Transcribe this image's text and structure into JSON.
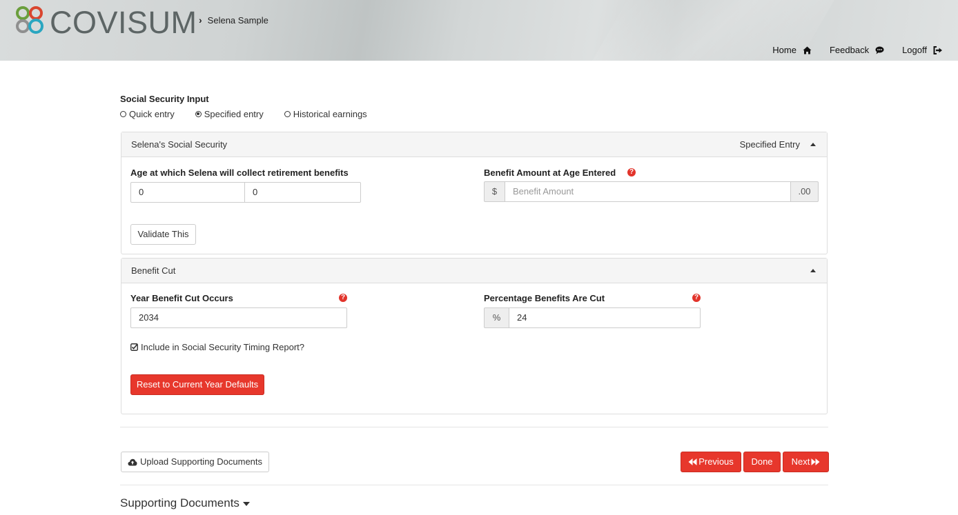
{
  "header": {
    "brand": "COVISUM",
    "breadcrumb": "Selena Sample",
    "nav": {
      "home": "Home",
      "feedback": "Feedback",
      "logoff": "Logoff"
    }
  },
  "ss_input": {
    "title": "Social Security Input",
    "options": {
      "quick": "Quick entry",
      "specified": "Specified entry",
      "historical": "Historical earnings"
    },
    "selected": "Specified entry"
  },
  "ss_panel": {
    "heading": "Selena's Social Security",
    "mode": "Specified Entry",
    "age_label": "Age at which Selena will collect retirement benefits",
    "age_years": "0",
    "age_months": "0",
    "benefit_label": "Benefit Amount at Age Entered",
    "benefit_prefix": "$",
    "benefit_placeholder": "Benefit Amount",
    "benefit_suffix": ".00",
    "validate_button": "Validate This"
  },
  "cut_panel": {
    "heading": "Benefit Cut",
    "year_label": "Year Benefit Cut Occurs",
    "year_value": "2034",
    "pct_label": "Percentage Benefits Are Cut",
    "pct_prefix": "%",
    "pct_value": "24",
    "include_label": "Include in Social Security Timing Report?",
    "include_checked": true,
    "reset_button": "Reset to Current Year Defaults"
  },
  "footer": {
    "upload_button": "Upload Supporting Documents",
    "previous_button": "Previous",
    "done_button": "Done",
    "next_button": "Next",
    "supporting_title": "Supporting Documents"
  },
  "colors": {
    "accent_red": "#e7372c",
    "panel_head": "#f5f5f5"
  }
}
